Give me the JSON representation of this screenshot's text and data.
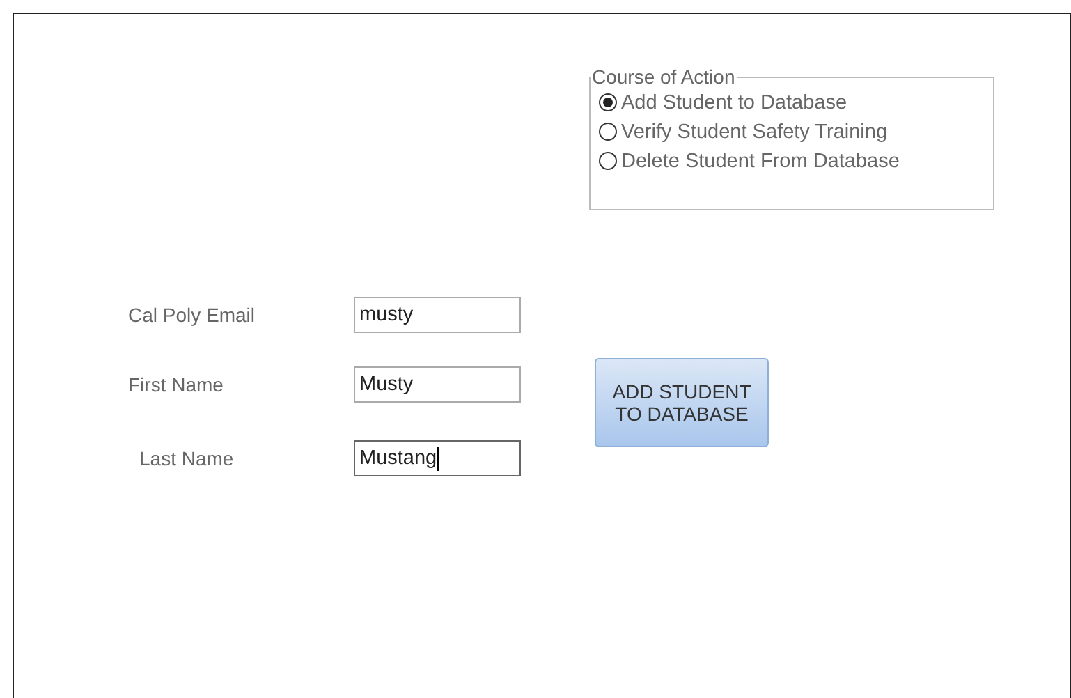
{
  "course_of_action": {
    "title": "Course of Action",
    "options": [
      {
        "label": "Add Student to Database",
        "selected": true
      },
      {
        "label": "Verify Student Safety Training",
        "selected": false
      },
      {
        "label": "Delete Student From Database",
        "selected": false
      }
    ]
  },
  "fields": [
    {
      "label": "Cal Poly Email",
      "value": "musty",
      "focused": false
    },
    {
      "label": "First Name",
      "value": "Musty",
      "focused": false
    },
    {
      "label": "Last Name",
      "value": "Mustang",
      "focused": true
    }
  ],
  "button": {
    "lines": [
      "ADD STUDENT",
      "TO DATABASE"
    ]
  }
}
